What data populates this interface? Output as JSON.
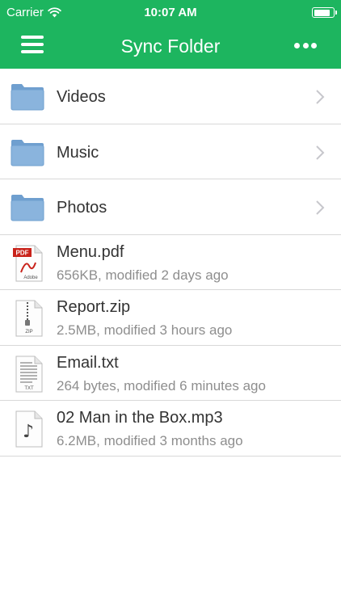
{
  "status_bar": {
    "carrier": "Carrier",
    "time": "10:07 AM",
    "battery_level": 0.9
  },
  "nav": {
    "title": "Sync Folder",
    "menu_icon": "hamburger-icon",
    "more_icon": "more-dots-icon"
  },
  "colors": {
    "header": "#1db55f",
    "folder": "#8ab4dd",
    "pdf": "#c9231b",
    "meta_text": "#8e8e8e"
  },
  "folders": [
    {
      "name": "Videos",
      "icon": "folder-icon"
    },
    {
      "name": "Music",
      "icon": "folder-icon"
    },
    {
      "name": "Photos",
      "icon": "folder-icon"
    }
  ],
  "files": [
    {
      "name": "Menu.pdf",
      "meta": "656KB, modified 2 days ago",
      "icon": "pdf-file-icon",
      "badge": "PDF",
      "badge_sub": "Adobe"
    },
    {
      "name": "Report.zip",
      "meta": "2.5MB, modified 3 hours ago",
      "icon": "zip-file-icon",
      "badge": "ZIP"
    },
    {
      "name": "Email.txt",
      "meta": "264 bytes, modified 6 minutes ago",
      "icon": "txt-file-icon",
      "badge": "TXT"
    },
    {
      "name": "02 Man in the Box.mp3",
      "meta": "6.2MB, modified 3 months ago",
      "icon": "music-file-icon",
      "badge": "♪"
    }
  ]
}
